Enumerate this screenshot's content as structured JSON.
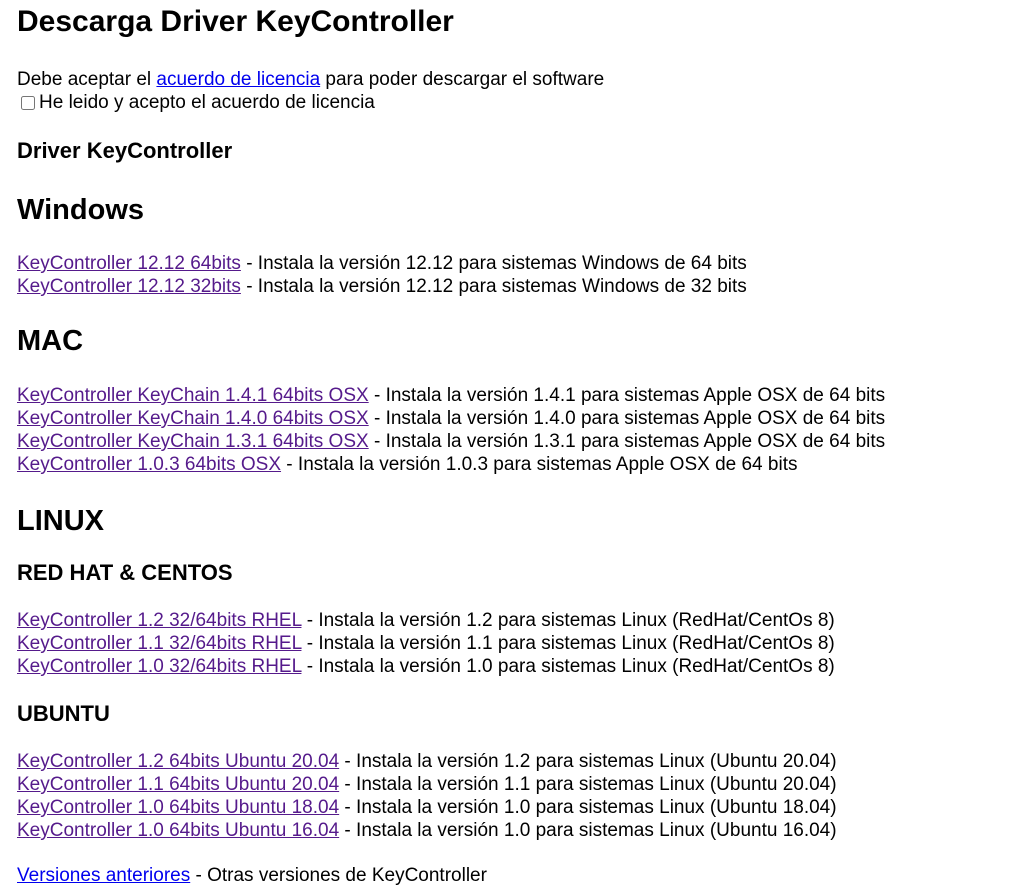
{
  "page": {
    "title": "Descarga Driver KeyController"
  },
  "license": {
    "prefix": "Debe aceptar el ",
    "link_label": "acuerdo de licencia",
    "suffix": " para poder descargar el software",
    "checkbox_label": "He leido y acepto el acuerdo de licencia"
  },
  "driver_heading": "Driver KeyController",
  "windows": {
    "heading": "Windows",
    "items": [
      {
        "link": "KeyController 12.12 64bits",
        "desc": " - Instala la versión 12.12 para sistemas Windows de 64 bits"
      },
      {
        "link": "KeyController 12.12 32bits",
        "desc": " - Instala la versión 12.12 para sistemas Windows de 32 bits"
      }
    ]
  },
  "mac": {
    "heading": "MAC",
    "items": [
      {
        "link": "KeyController KeyChain 1.4.1 64bits OSX",
        "desc": " - Instala la versión 1.4.1 para sistemas Apple OSX de 64 bits"
      },
      {
        "link": "KeyController KeyChain 1.4.0 64bits OSX",
        "desc": " - Instala la versión 1.4.0 para sistemas Apple OSX de 64 bits"
      },
      {
        "link": "KeyController KeyChain 1.3.1 64bits OSX",
        "desc": " - Instala la versión 1.3.1 para sistemas Apple OSX de 64 bits"
      },
      {
        "link": "KeyController 1.0.3 64bits OSX",
        "desc": " - Instala la versión 1.0.3 para sistemas Apple OSX de 64 bits"
      }
    ]
  },
  "linux": {
    "heading": "LINUX",
    "redhat": {
      "heading": "RED HAT & CENTOS",
      "items": [
        {
          "link": "KeyController 1.2 32/64bits RHEL",
          "desc": " - Instala la versión 1.2 para sistemas Linux (RedHat/CentOs 8)"
        },
        {
          "link": "KeyController 1.1 32/64bits RHEL",
          "desc": " - Instala la versión 1.1 para sistemas Linux (RedHat/CentOs 8)"
        },
        {
          "link": "KeyController 1.0 32/64bits RHEL",
          "desc": " - Instala la versión 1.0 para sistemas Linux (RedHat/CentOs 8)"
        }
      ]
    },
    "ubuntu": {
      "heading": "UBUNTU",
      "items": [
        {
          "link": "KeyController 1.2 64bits Ubuntu 20.04",
          "desc": " - Instala la versión 1.2 para sistemas Linux (Ubuntu 20.04)"
        },
        {
          "link": "KeyController 1.1 64bits Ubuntu 20.04",
          "desc": " - Instala la versión 1.1 para sistemas Linux (Ubuntu 20.04)"
        },
        {
          "link": "KeyController 1.0 64bits Ubuntu 18.04",
          "desc": " - Instala la versión 1.0 para sistemas Linux (Ubuntu 18.04)"
        },
        {
          "link": "KeyController 1.0 64bits Ubuntu 16.04",
          "desc": " - Instala la versión 1.0 para sistemas Linux (Ubuntu 16.04)"
        }
      ]
    }
  },
  "other_versions": {
    "link": "Versiones anteriores",
    "desc": " - Otras versiones de KeyController"
  }
}
